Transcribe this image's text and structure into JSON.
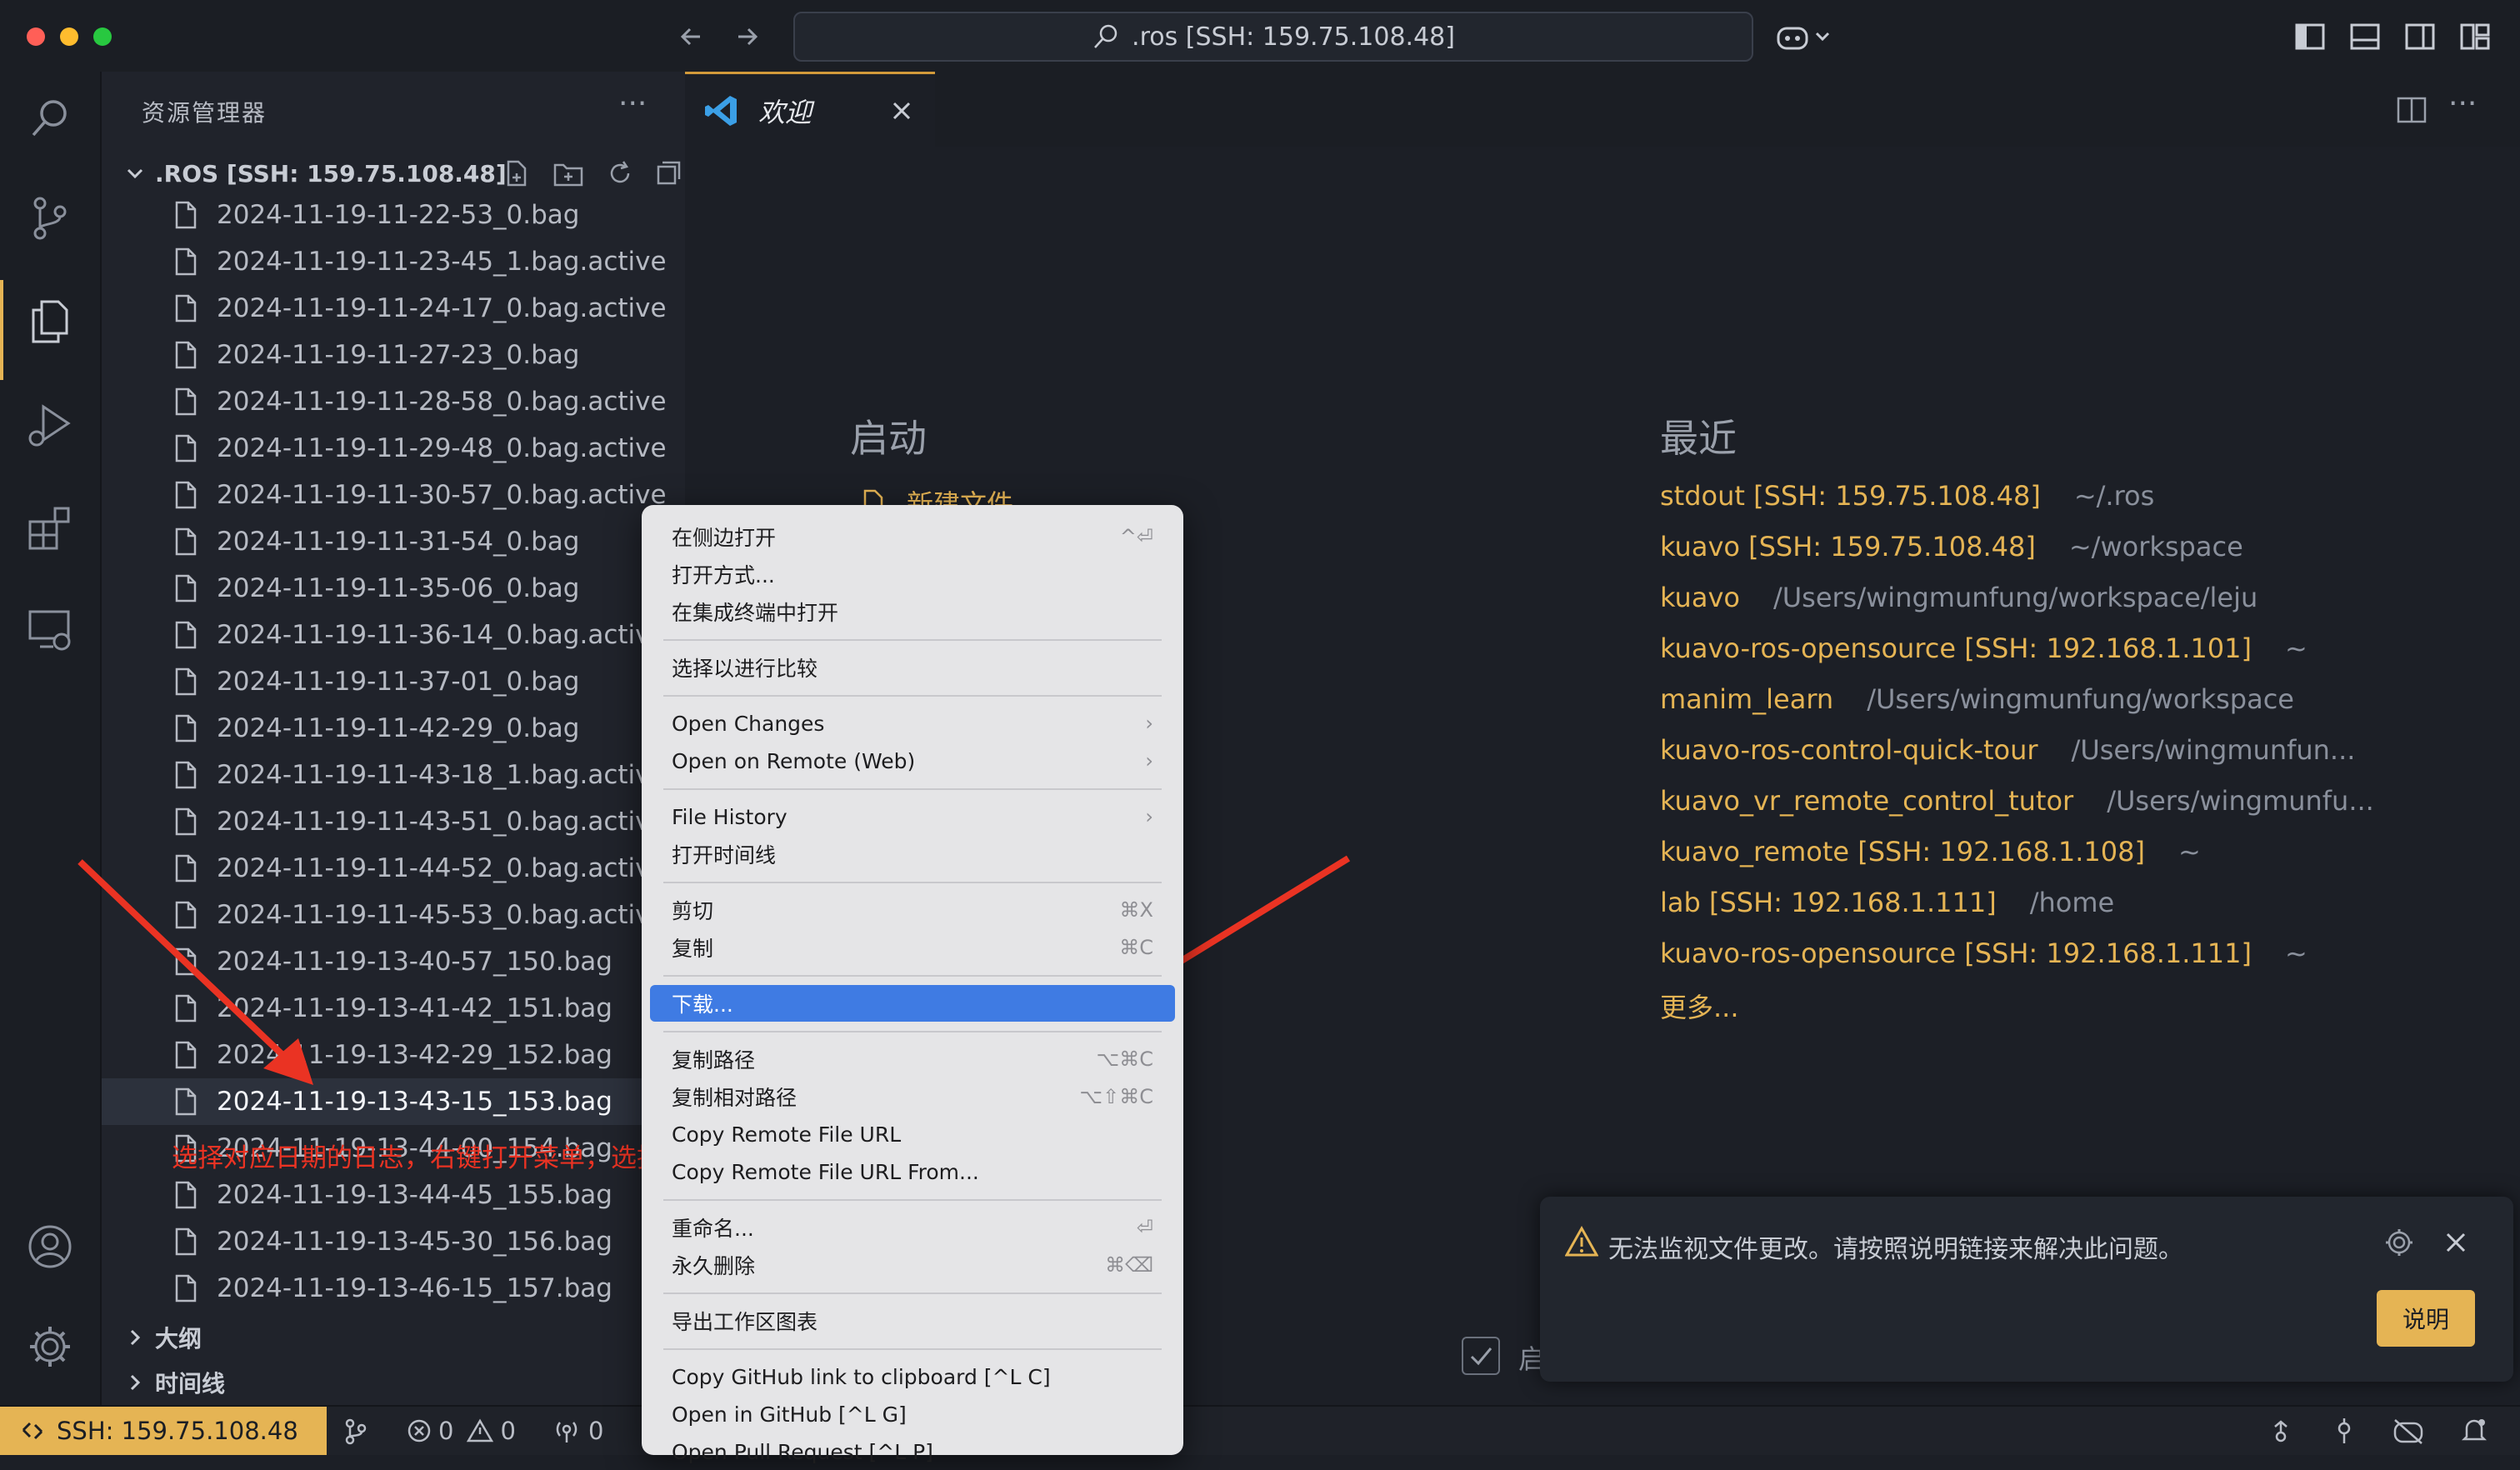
{
  "titlebar": {
    "search_text": ".ros [SSH: 159.75.108.48]",
    "buttons": [
      "back-arrow-icon",
      "forward-arrow-icon",
      "copilot-icon",
      "toggle-sidebar-icon",
      "toggle-panel-icon",
      "toggle-secondary-sidebar-icon",
      "customize-layout-icon"
    ]
  },
  "activitybar": {
    "icons": [
      "search-icon",
      "source-control-icon",
      "explorer-icon",
      "run-debug-icon",
      "extensions-icon",
      "remote-explorer-icon",
      "account-icon",
      "settings-gear-icon"
    ]
  },
  "sidebar": {
    "title": "资源管理器",
    "more": "···",
    "folder": ".ROS [SSH: 159.75.108.48]",
    "files": [
      "2024-11-19-11-22-53_0.bag",
      "2024-11-19-11-23-45_1.bag.active",
      "2024-11-19-11-24-17_0.bag.active",
      "2024-11-19-11-27-23_0.bag",
      "2024-11-19-11-28-58_0.bag.active",
      "2024-11-19-11-29-48_0.bag.active",
      "2024-11-19-11-30-57_0.bag.active",
      "2024-11-19-11-31-54_0.bag",
      "2024-11-19-11-35-06_0.bag",
      "2024-11-19-11-36-14_0.bag.active",
      "2024-11-19-11-37-01_0.bag",
      "2024-11-19-11-42-29_0.bag",
      "2024-11-19-11-43-18_1.bag.active",
      "2024-11-19-11-43-51_0.bag.active",
      "2024-11-19-11-44-52_0.bag.active",
      "2024-11-19-11-45-53_0.bag.active",
      "2024-11-19-13-40-57_150.bag",
      "2024-11-19-13-41-42_151.bag",
      "2024-11-19-13-42-29_152.bag",
      "2024-11-19-13-43-15_153.bag",
      "2024-11-19-13-44-00_154.bag",
      "2024-11-19-13-44-45_155.bag",
      "2024-11-19-13-45-30_156.bag",
      "2024-11-19-13-46-15_157.bag"
    ],
    "selected_file": "2024-11-19-13-43-15_153.bag",
    "outline": "大纲",
    "timeline": "时间线"
  },
  "editor": {
    "tab_label": "欢迎",
    "start_heading": "启动",
    "new_file": "新建文件...",
    "recent_heading": "最近",
    "recent": [
      {
        "name": "stdout [SSH: 159.75.108.48]",
        "path": "~/.ros"
      },
      {
        "name": "kuavo [SSH: 159.75.108.48]",
        "path": "~/workspace"
      },
      {
        "name": "kuavo",
        "path": "/Users/wingmunfung/workspace/leju"
      },
      {
        "name": "kuavo-ros-opensource [SSH: 192.168.1.101]",
        "path": "~"
      },
      {
        "name": "manim_learn",
        "path": "/Users/wingmunfung/workspace"
      },
      {
        "name": "kuavo-ros-control-quick-tour",
        "path": "/Users/wingmunfun..."
      },
      {
        "name": "kuavo_vr_remote_control_tutor",
        "path": "/Users/wingmunfu..."
      },
      {
        "name": "kuavo_remote [SSH: 192.168.1.108]",
        "path": "~"
      },
      {
        "name": "lab [SSH: 192.168.1.111]",
        "path": "/home"
      },
      {
        "name": "kuavo-ros-opensource [SSH: 192.168.1.111]",
        "path": "~"
      }
    ],
    "more": "更多...",
    "startup_checkbox_label": "启"
  },
  "context_menu": {
    "items": [
      {
        "label": "在侧边打开",
        "shortcut": "^⏎"
      },
      {
        "label": "打开方式...",
        "shortcut": ""
      },
      {
        "label": "在集成终端中打开",
        "shortcut": ""
      },
      {
        "sep": true
      },
      {
        "label": "选择以进行比较",
        "shortcut": ""
      },
      {
        "sep": true
      },
      {
        "label": "Open Changes",
        "shortcut": "›"
      },
      {
        "label": "Open on Remote (Web)",
        "shortcut": "›"
      },
      {
        "sep": true
      },
      {
        "label": "File History",
        "shortcut": "›"
      },
      {
        "label": "打开时间线",
        "shortcut": ""
      },
      {
        "sep": true
      },
      {
        "label": "剪切",
        "shortcut": "⌘X"
      },
      {
        "label": "复制",
        "shortcut": "⌘C"
      },
      {
        "sep": true
      },
      {
        "label": "下载...",
        "shortcut": "",
        "highlight": true
      },
      {
        "sep": true
      },
      {
        "label": "复制路径",
        "shortcut": "⌥⌘C"
      },
      {
        "label": "复制相对路径",
        "shortcut": "⌥⇧⌘C"
      },
      {
        "label": "Copy Remote File URL",
        "shortcut": ""
      },
      {
        "label": "Copy Remote File URL From...",
        "shortcut": ""
      },
      {
        "sep": true
      },
      {
        "label": "重命名...",
        "shortcut": "⏎"
      },
      {
        "label": "永久删除",
        "shortcut": "⌘⌫"
      },
      {
        "sep": true
      },
      {
        "label": "导出工作区图表",
        "shortcut": ""
      },
      {
        "sep": true
      },
      {
        "label": "Copy GitHub link to clipboard [^L C]",
        "shortcut": ""
      },
      {
        "label": "Open in GitHub [^L G]",
        "shortcut": ""
      },
      {
        "label": "Open Pull Request [^L P]",
        "shortcut": ""
      }
    ]
  },
  "notification": {
    "text": "无法监视文件更改。请按照说明链接来解决此问题。",
    "button": "说明"
  },
  "statusbar": {
    "remote": "SSH: 159.75.108.48",
    "errors": "0",
    "warnings": "0",
    "ports": "0"
  },
  "annotation": {
    "text": "选择对应日期的日志，右键打开菜单，选择下载"
  },
  "colors": {
    "accent": "#e5b454",
    "menu_highlight": "#3f7be3",
    "annotation": "#ea3323"
  }
}
